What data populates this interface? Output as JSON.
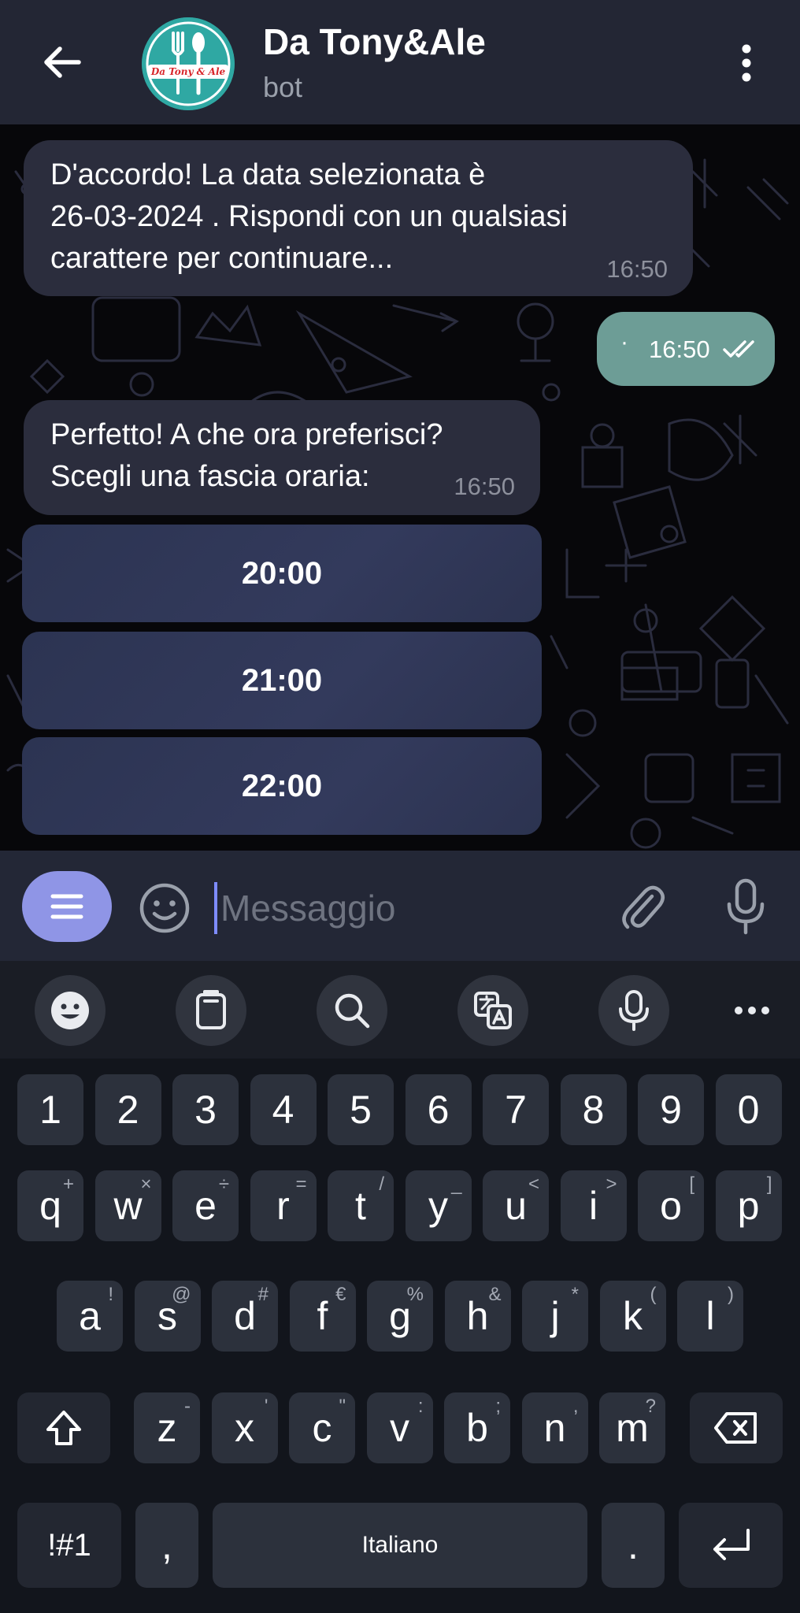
{
  "header": {
    "title": "Da Tony&Ale",
    "subtitle": "bot",
    "avatar_text": "Da Tony & Ale"
  },
  "messages": [
    {
      "direction": "in",
      "text": "D'accordo! La data selezionata è 26-03-2024 . Rispondi con un qualsiasi carattere per continuare...",
      "line1": "D'accordo! La data selezionata è",
      "line2": "26-03-2024 . Rispondi con un qualsiasi",
      "line3": "carattere per continuare...",
      "time": "16:50"
    },
    {
      "direction": "out",
      "text": "·",
      "time": "16:50",
      "status": "read-double-check-icon"
    },
    {
      "direction": "in",
      "line1": "Perfetto! A che ora preferisci?",
      "line2": "Scegli una fascia oraria:",
      "time": "16:50"
    }
  ],
  "inline_keyboard": [
    "20:00",
    "21:00",
    "22:00"
  ],
  "composer": {
    "placeholder": "Messaggio",
    "value": ""
  },
  "keyboard": {
    "toolbar": [
      "emoji-icon",
      "clipboard-icon",
      "search-icon",
      "translate-icon",
      "mic-icon",
      "more-icon"
    ],
    "row_numbers": [
      "1",
      "2",
      "3",
      "4",
      "5",
      "6",
      "7",
      "8",
      "9",
      "0"
    ],
    "row1": [
      {
        "k": "q",
        "alt": "+"
      },
      {
        "k": "w",
        "alt": "×"
      },
      {
        "k": "e",
        "alt": "÷"
      },
      {
        "k": "r",
        "alt": "="
      },
      {
        "k": "t",
        "alt": "/"
      },
      {
        "k": "y",
        "alt": "_"
      },
      {
        "k": "u",
        "alt": "<"
      },
      {
        "k": "i",
        "alt": ">"
      },
      {
        "k": "o",
        "alt": "["
      },
      {
        "k": "p",
        "alt": "]"
      }
    ],
    "row2": [
      {
        "k": "a",
        "alt": "!"
      },
      {
        "k": "s",
        "alt": "@"
      },
      {
        "k": "d",
        "alt": "#"
      },
      {
        "k": "f",
        "alt": "€"
      },
      {
        "k": "g",
        "alt": "%"
      },
      {
        "k": "h",
        "alt": "&"
      },
      {
        "k": "j",
        "alt": "*"
      },
      {
        "k": "k",
        "alt": "("
      },
      {
        "k": "l",
        "alt": ")"
      }
    ],
    "row3": [
      {
        "k": "z",
        "alt": "-"
      },
      {
        "k": "x",
        "alt": "'"
      },
      {
        "k": "c",
        "alt": "\""
      },
      {
        "k": "v",
        "alt": ":"
      },
      {
        "k": "b",
        "alt": ";"
      },
      {
        "k": "n",
        "alt": ","
      },
      {
        "k": "m",
        "alt": "?"
      }
    ],
    "symbols_label": "!#1",
    "comma_label": ",",
    "space_label": "Italiano",
    "period_label": "."
  },
  "colors": {
    "header_bg": "#232634",
    "bubble_in": "#2b2d3d",
    "bubble_out": "#6d9d96",
    "accent": "#8f95e6",
    "keyboard_bg": "#12151c",
    "key_bg": "#2c313c"
  }
}
